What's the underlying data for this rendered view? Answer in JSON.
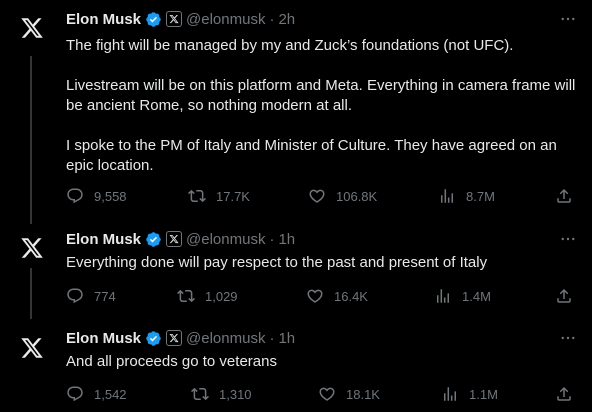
{
  "tweets": [
    {
      "author_name": "Elon Musk",
      "handle": "@elonmusk",
      "separator": "·",
      "time": "2h",
      "paragraphs": [
        "The fight will be managed by my and Zuck’s foundations (not UFC).",
        "Livestream will be on this platform and Meta. Everything in camera frame will be ancient Rome, so nothing modern at all.",
        "I spoke to the PM of Italy and Minister of Culture. They have agreed on an epic location."
      ],
      "replies": "9,558",
      "reposts": "17.7K",
      "likes": "106.8K",
      "views": "8.7M"
    },
    {
      "author_name": "Elon Musk",
      "handle": "@elonmusk",
      "separator": "·",
      "time": "1h",
      "paragraphs": [
        "Everything done will pay respect to the past and present of Italy"
      ],
      "replies": "774",
      "reposts": "1,029",
      "likes": "16.4K",
      "views": "1.4M"
    },
    {
      "author_name": "Elon Musk",
      "handle": "@elonmusk",
      "separator": "·",
      "time": "1h",
      "paragraphs": [
        "And all proceeds go to veterans"
      ],
      "replies": "1,542",
      "reposts": "1,310",
      "likes": "18.1K",
      "views": "1.1M"
    }
  ],
  "icons": {
    "avatar": "x-logo-icon",
    "verified": "verified-badge-icon",
    "affiliate": "x-affiliate-badge-icon",
    "more": "more-options-icon",
    "reply": "reply-icon",
    "repost": "repost-icon",
    "like": "like-icon",
    "views": "views-icon",
    "share": "share-icon"
  },
  "colors": {
    "background": "#000000",
    "text": "#e7e9ea",
    "muted": "#71767b",
    "verified": "#1d9bf0",
    "divider": "#2f3336"
  }
}
